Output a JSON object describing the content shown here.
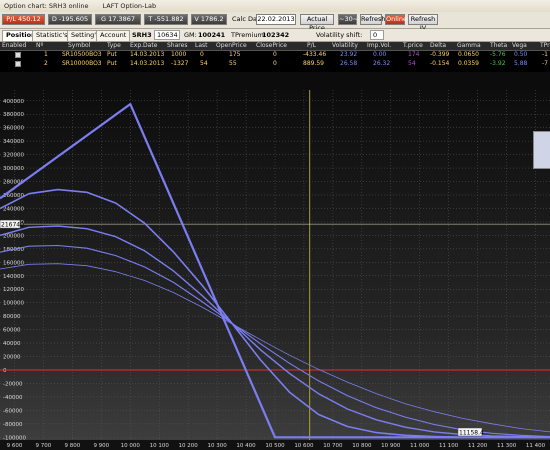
{
  "window": {
    "title1": "Option chart: SRH3 online",
    "title2": "LAFT Option-Lab"
  },
  "toolbar": {
    "pl": "P/L 450.12",
    "d": "D -195.605",
    "g": "G 17.3867",
    "t": "T -551.882",
    "v": "V 1786.2",
    "calc_date_label": "Calc Date:",
    "calc_date": "22.02.2013",
    "actual_price": "Actual Price",
    "days": "~30~",
    "refresh": "Refresh",
    "online": "Online",
    "refresh_iv": "Refresh IV"
  },
  "tabs": {
    "positions": "Position's",
    "statistics": "Statistic's",
    "settings": "Setting's",
    "account": "Account"
  },
  "account": {
    "symbol": "SRH3",
    "quantity": "10634",
    "gm_label": "GM:",
    "gm": "100241",
    "tpremium_label": "TPremium:",
    "tpremium": "102342",
    "vol_shift_label": "Volatility shift:",
    "vol_shift": "0"
  },
  "table": {
    "headers": [
      "Enabled",
      "Nº",
      "Symbol",
      "Type",
      "Exp.Date",
      "Shares",
      "Last",
      "OpenPrice",
      "ClosePrice",
      "P/L",
      "Volatility",
      "Imp.Vol.",
      "T.price",
      "Delta",
      "Gamma",
      "Theta",
      "Vega",
      "TPre"
    ],
    "rows": [
      [
        "1",
        "SR10500BO3",
        "Put",
        "14.03.2013",
        "1000",
        "0",
        "175",
        "0",
        "-433.46",
        "23.92",
        "0.00",
        "174",
        "-0.399",
        "0.0650",
        "-5.76",
        "0.50",
        "-1"
      ],
      [
        "2",
        "SR10000BO3",
        "Put",
        "14.03.2013",
        "-1327",
        "54",
        "55",
        "0",
        "889.59",
        "26.58",
        "26.32",
        "54",
        "-0.154",
        "0.0359",
        "-3.92",
        "5.88",
        "-7"
      ]
    ]
  },
  "chart_data": {
    "type": "line",
    "x_ticks": [
      "9 600",
      "9 700",
      "9 800",
      "9 900",
      "10 000",
      "10 100",
      "10 200",
      "10 300",
      "10 400",
      "10 500",
      "10 600",
      "10 700",
      "10 800",
      "10 900",
      "11 000",
      "11 100",
      "11 200",
      "11 300",
      "11 400"
    ],
    "y_ticks": [
      "400000",
      "380000",
      "360000",
      "340000",
      "320000",
      "300000",
      "280000",
      "260000",
      "240000",
      "220000",
      "200000",
      "180000",
      "160000",
      "140000",
      "120000",
      "100000",
      "80000",
      "60000",
      "40000",
      "20000",
      "0",
      "-20000",
      "-40000",
      "-60000",
      "-80000",
      "-100000"
    ],
    "ylim": [
      -104000,
      416000
    ],
    "xlim": [
      9550,
      11450
    ],
    "current_price_label": "216740",
    "price_marker_label": "11158.4",
    "current_x": 10620,
    "current_y": 216740,
    "series": [
      {
        "x": [
          9550,
          10000,
          10500,
          11450
        ],
        "y": [
          255000,
          395000,
          -100000,
          -100000
        ],
        "width": 2.2
      },
      {
        "x": [
          9550,
          9650,
          9750,
          9850,
          9950,
          10050,
          10150,
          10250,
          10350,
          10450,
          10550,
          10650,
          10750,
          10850,
          10950,
          11050,
          11150,
          11250,
          11350,
          11450
        ],
        "y": [
          240000,
          262000,
          268000,
          264000,
          248000,
          218000,
          175000,
          125000,
          70000,
          15000,
          -33000,
          -66000,
          -84000,
          -93000,
          -97000,
          -99000,
          -100000,
          -100000,
          -100000,
          -100000
        ],
        "width": 1.6
      },
      {
        "x": [
          9550,
          9650,
          9750,
          9850,
          9950,
          10050,
          10150,
          10250,
          10350,
          10450,
          10550,
          10650,
          10750,
          10850,
          10950,
          11050,
          11150,
          11250,
          11350,
          11450
        ],
        "y": [
          200000,
          212000,
          214000,
          210000,
          198000,
          177000,
          147000,
          110000,
          70000,
          30000,
          -5000,
          -35000,
          -58000,
          -74000,
          -85000,
          -92000,
          -96000,
          -98000,
          -99000,
          -100000
        ],
        "width": 1.4
      },
      {
        "x": [
          9550,
          9650,
          9750,
          9850,
          9950,
          10050,
          10150,
          10250,
          10350,
          10450,
          10550,
          10650,
          10750,
          10850,
          10950,
          11050,
          11150,
          11250,
          11350,
          11450
        ],
        "y": [
          175000,
          184000,
          185000,
          181000,
          170000,
          153000,
          130000,
          101000,
          70000,
          39000,
          10000,
          -16000,
          -38000,
          -56000,
          -70000,
          -81000,
          -89000,
          -94000,
          -97000,
          -99000
        ],
        "width": 1.1
      },
      {
        "x": [
          9550,
          9650,
          9750,
          9850,
          9950,
          10050,
          10150,
          10250,
          10350,
          10450,
          10550,
          10650,
          10750,
          10850,
          10950,
          11050,
          11150,
          11250,
          11350,
          11450
        ],
        "y": [
          150000,
          157000,
          158000,
          155000,
          146000,
          133000,
          115000,
          93000,
          69000,
          45000,
          22000,
          1000,
          -18000,
          -35000,
          -50000,
          -62000,
          -72000,
          -80000,
          -87000,
          -92000
        ],
        "width": 0.8
      }
    ],
    "colors": {
      "curve": "#7b7ef0",
      "zero_line": "#e03030",
      "cursor": "#c9c22a",
      "grid": "#5a5a5a"
    }
  }
}
